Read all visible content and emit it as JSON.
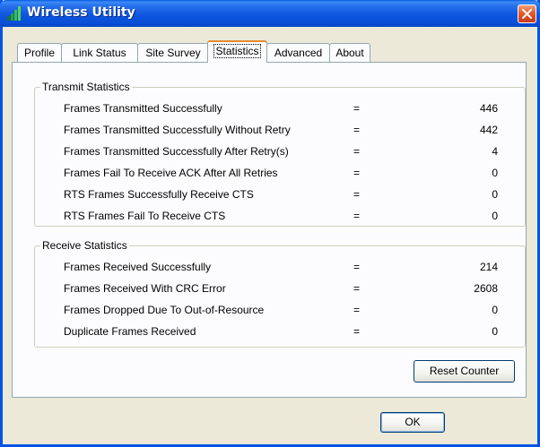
{
  "window": {
    "title": "Wireless Utility",
    "icon": "signal-bars-icon",
    "close_icon": "close-icon"
  },
  "tabs": [
    {
      "label": "Profile",
      "active": false
    },
    {
      "label": "Link Status",
      "active": false
    },
    {
      "label": "Site Survey",
      "active": false
    },
    {
      "label": "Statistics",
      "active": true
    },
    {
      "label": "Advanced",
      "active": false
    },
    {
      "label": "About",
      "active": false
    }
  ],
  "transmit": {
    "title": "Transmit Statistics",
    "rows": [
      {
        "label": "Frames Transmitted Successfully",
        "eq": "=",
        "value": "446"
      },
      {
        "label": "Frames Transmitted Successfully  Without Retry",
        "eq": "=",
        "value": "442"
      },
      {
        "label": "Frames Transmitted Successfully After Retry(s)",
        "eq": "=",
        "value": "4"
      },
      {
        "label": "Frames Fail To Receive ACK After All Retries",
        "eq": "=",
        "value": "0"
      },
      {
        "label": "RTS Frames Successfully Receive CTS",
        "eq": "=",
        "value": "0"
      },
      {
        "label": "RTS Frames Fail To Receive CTS",
        "eq": "=",
        "value": "0"
      }
    ]
  },
  "receive": {
    "title": "Receive Statistics",
    "rows": [
      {
        "label": "Frames Received Successfully",
        "eq": "=",
        "value": "214"
      },
      {
        "label": "Frames Received With CRC Error",
        "eq": "=",
        "value": "2608"
      },
      {
        "label": "Frames Dropped Due To Out-of-Resource",
        "eq": "=",
        "value": "0"
      },
      {
        "label": "Duplicate Frames Received",
        "eq": "=",
        "value": "0"
      }
    ]
  },
  "buttons": {
    "reset_label": "Reset Counter",
    "ok_label": "OK"
  },
  "colors": {
    "titlebar": "#0a4fd6",
    "window_bg": "#ece9d8",
    "panel_bg": "#fcfcfe",
    "active_tab_accent": "#e68b2c",
    "close_button": "#e35a2a"
  }
}
